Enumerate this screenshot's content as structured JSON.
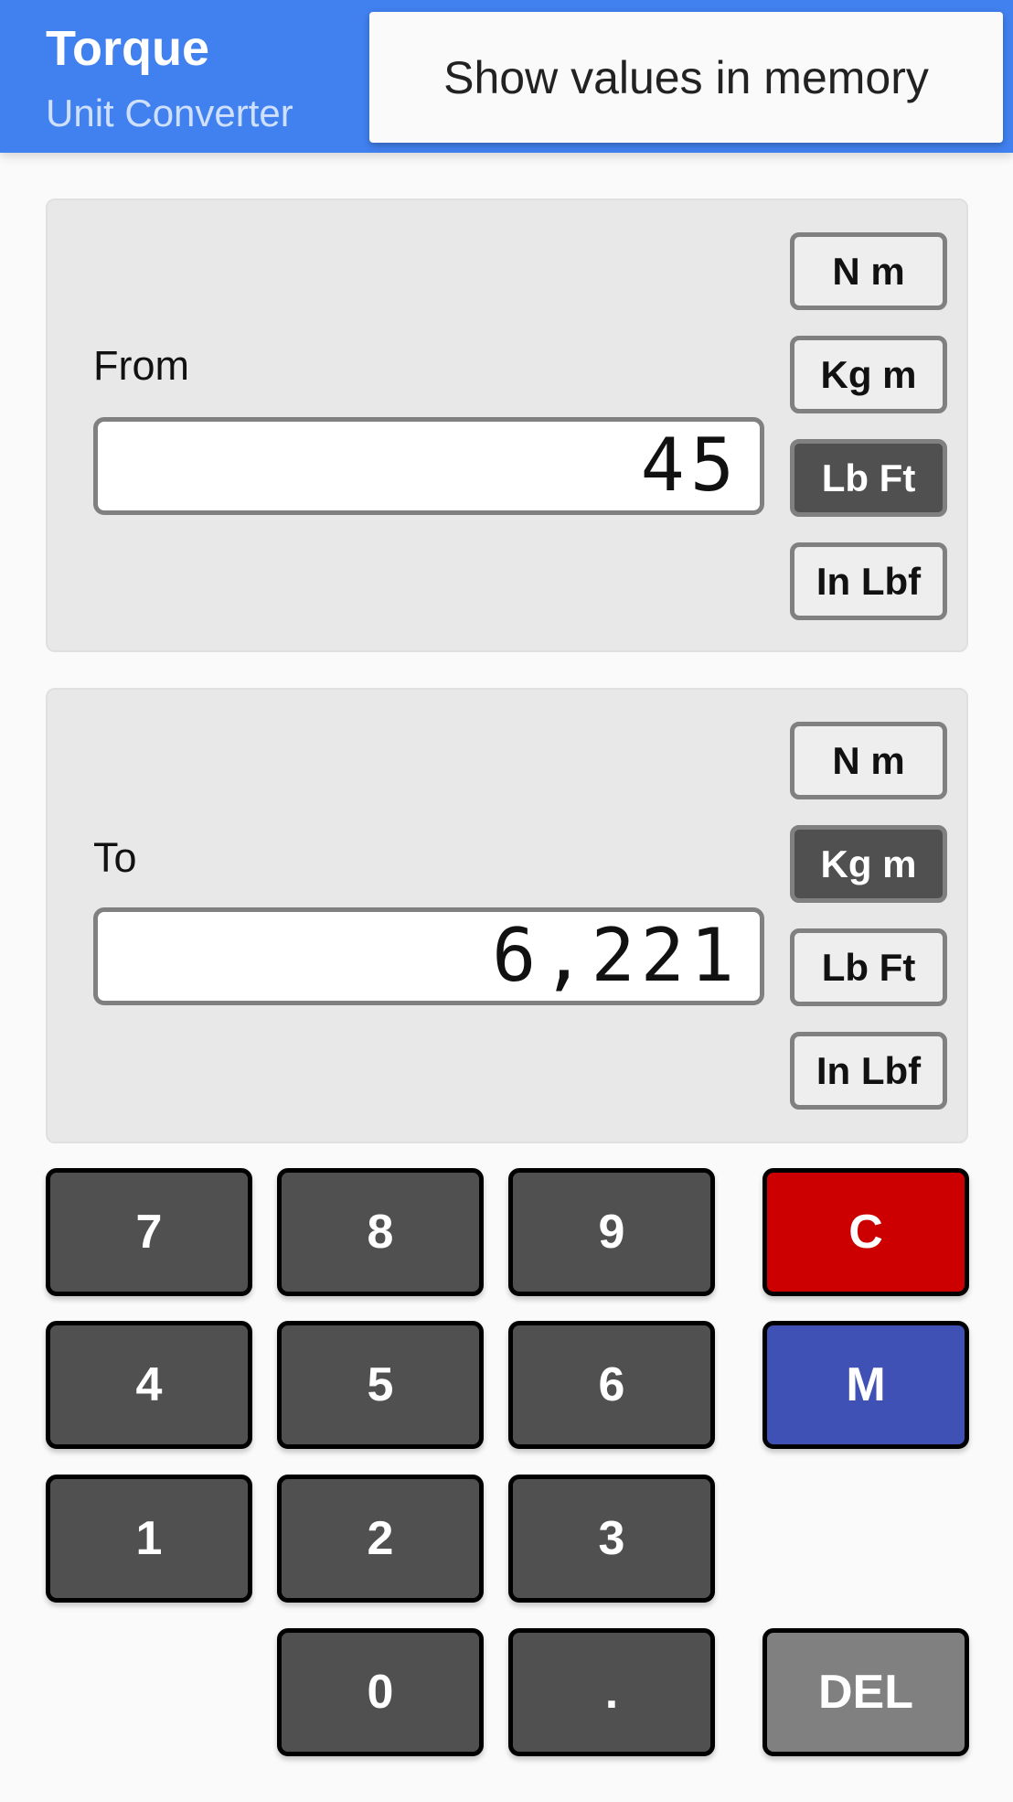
{
  "header": {
    "title": "Torque",
    "subtitle": "Unit Converter",
    "menu_item": "Show values in memory"
  },
  "from": {
    "label": "From",
    "value": "45",
    "units": [
      "N m",
      "Kg m",
      "Lb Ft",
      "In Lbf"
    ],
    "selected": "Lb Ft"
  },
  "to": {
    "label": "To",
    "value": "6,221",
    "units": [
      "N m",
      "Kg m",
      "Lb Ft",
      "In Lbf"
    ],
    "selected": "Kg m"
  },
  "keys": {
    "k7": "7",
    "k8": "8",
    "k9": "9",
    "c": "C",
    "k4": "4",
    "k5": "5",
    "k6": "6",
    "m": "M",
    "k1": "1",
    "k2": "2",
    "k3": "3",
    "k0": "0",
    "dot": ".",
    "del": "DEL"
  },
  "colors": {
    "header": "#4180ef",
    "clear": "#cc0000",
    "memory": "#3f51b5",
    "delete": "#808080",
    "key": "#505050"
  }
}
